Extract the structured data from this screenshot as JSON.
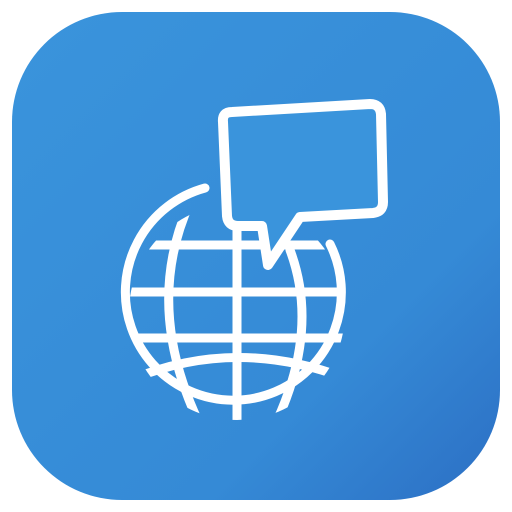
{
  "app_icon": {
    "icon": "globe-chat-icon",
    "colors": {
      "background_top": "#3a94dc",
      "background_bottom": "#2c6fc4",
      "glyph": "#ffffff"
    }
  }
}
